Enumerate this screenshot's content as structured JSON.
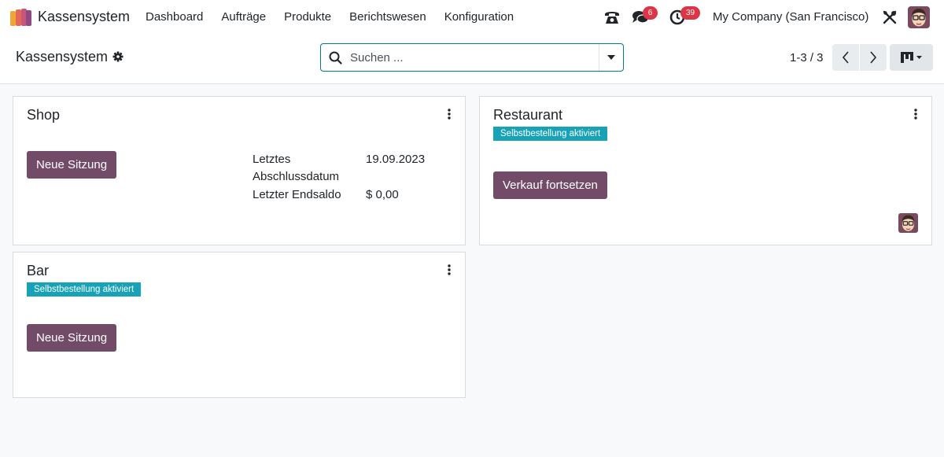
{
  "app": {
    "name": "Kassensystem",
    "logo_icon": "pos-app-logo-icon"
  },
  "menu": {
    "items": [
      "Dashboard",
      "Aufträge",
      "Produkte",
      "Berichtswesen",
      "Konfiguration"
    ]
  },
  "systray": {
    "phone_icon": "phone-icon",
    "chat_icon": "chat-icon",
    "chat_count": "6",
    "activity_icon": "clock-icon",
    "activity_count": "39",
    "company": "My Company (San Francisco)",
    "debug_icon": "debug-tools-icon",
    "badge_color": "#dc3545"
  },
  "control_panel": {
    "breadcrumb": "Kassensystem",
    "search_placeholder": "Suchen ...",
    "pager": "1-3 / 3"
  },
  "colors": {
    "primary": "#714b67",
    "tag": "#17a2b8",
    "focus": "#017e84"
  },
  "cards": [
    {
      "title": "Shop",
      "button": "Neue Sitzung",
      "stats": [
        {
          "label": "Letztes Abschlussdatum",
          "value": "19.09.2023"
        },
        {
          "label": "Letzter Endsaldo",
          "value": "$ 0,00"
        }
      ]
    },
    {
      "title": "Restaurant",
      "tag": "Selbstbestellung aktiviert",
      "button": "Verkauf fortsetzen"
    },
    {
      "title": "Bar",
      "tag": "Selbstbestellung aktiviert",
      "button": "Neue Sitzung"
    }
  ]
}
